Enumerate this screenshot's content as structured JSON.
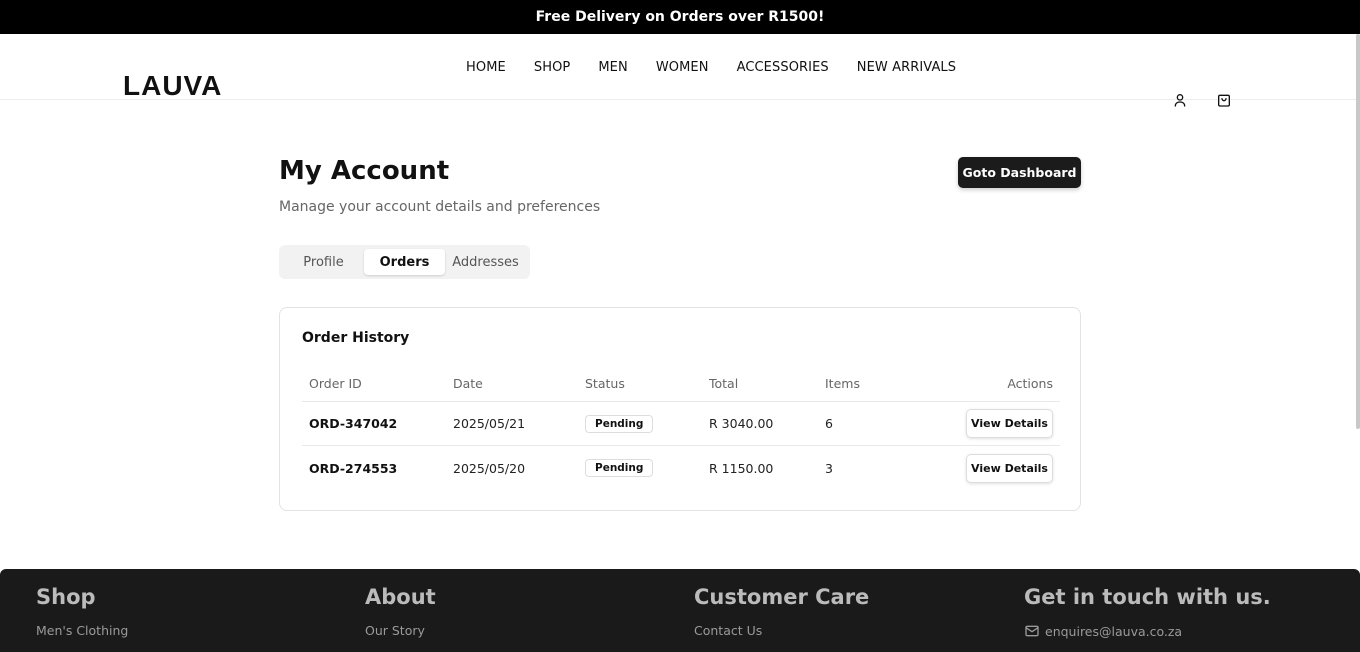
{
  "announcement": "Free Delivery on Orders over R1500!",
  "brand": {
    "logo": "LAUVA"
  },
  "nav": [
    "HOME",
    "SHOP",
    "MEN",
    "WOMEN",
    "ACCESSORIES",
    "NEW ARRIVALS"
  ],
  "header_icons": [
    "user-icon",
    "shopping-bag-icon"
  ],
  "account": {
    "title": "My Account",
    "subtitle": "Manage your account details and preferences",
    "dashboard_button": "Goto Dashboard"
  },
  "tabs": [
    {
      "label": "Profile",
      "active": false
    },
    {
      "label": "Orders",
      "active": true
    },
    {
      "label": "Addresses",
      "active": false
    }
  ],
  "orders": {
    "title": "Order History",
    "columns": [
      "Order ID",
      "Date",
      "Status",
      "Total",
      "Items",
      "Actions"
    ],
    "rows": [
      {
        "id": "ORD-347042",
        "date": "2025/05/21",
        "status": "Pending",
        "total": "R 3040.00",
        "items": "6",
        "action": "View Details"
      },
      {
        "id": "ORD-274553",
        "date": "2025/05/20",
        "status": "Pending",
        "total": "R 1150.00",
        "items": "3",
        "action": "View Details"
      }
    ]
  },
  "footer": {
    "columns": [
      {
        "heading": "Shop",
        "link": "Men's Clothing"
      },
      {
        "heading": "About",
        "link": "Our Story"
      },
      {
        "heading": "Customer Care",
        "link": "Contact Us"
      },
      {
        "heading": "Get in touch with us.",
        "link": "enquires@lauva.co.za",
        "icon": "mail-icon"
      }
    ]
  },
  "colors": {
    "announcement_bg": "#000000",
    "primary_button": "#1b1b1b",
    "footer_bg": "#1a1a1a"
  }
}
